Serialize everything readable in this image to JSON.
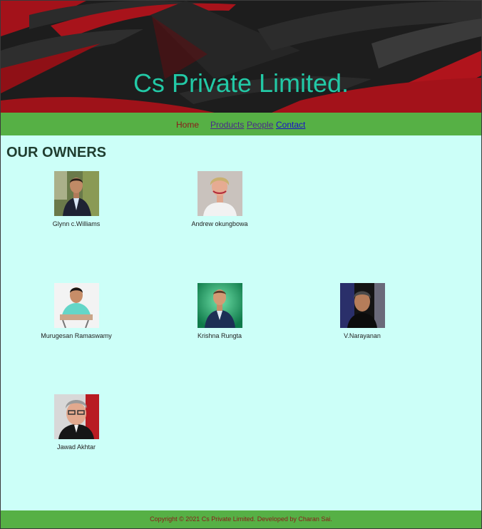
{
  "header": {
    "title": "Cs Private Limited."
  },
  "nav": {
    "home": "Home",
    "products": "Products",
    "people": "People",
    "contact": "Contact"
  },
  "section": {
    "heading": "OUR OWNERS"
  },
  "owners": [
    {
      "name": "Glynn c.Williams"
    },
    {
      "name": "Andrew okungbowa"
    },
    {
      "name": "Murugesan Ramaswamy"
    },
    {
      "name": "Krishna Rungta"
    },
    {
      "name": "V.Narayanan"
    },
    {
      "name": "Jawad Akhtar"
    }
  ],
  "footer": {
    "copyright": "Copyright © 2021 Cs Private Limited. Developed by Charan Sai."
  },
  "colors": {
    "accent": "#22c9a6",
    "nav_green": "#56b045",
    "page_bg": "#ccfff8",
    "header_red": "#b0141c"
  }
}
